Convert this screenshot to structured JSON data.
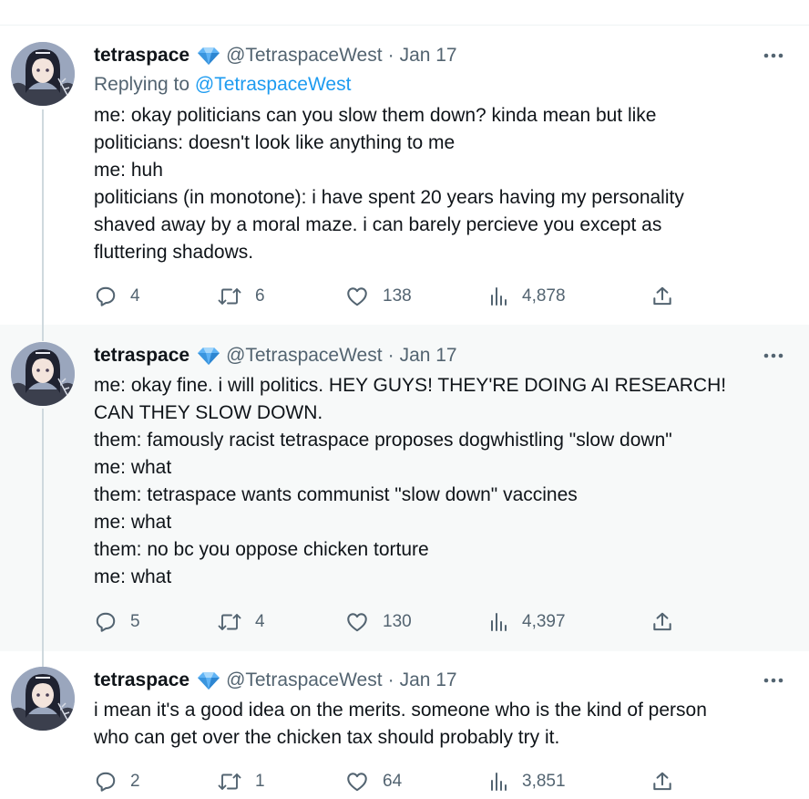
{
  "tweets": [
    {
      "name": "tetraspace",
      "handle": "@TetraspaceWest",
      "separator": "·",
      "date": "Jan 17",
      "replying_prefix": "Replying to ",
      "replying_handle": "@TetraspaceWest",
      "lines": [
        "me: okay politicians can you slow them down? kinda mean but like",
        "politicians: doesn't look like anything to me",
        "me: huh",
        "politicians (in monotone): i have spent 20 years having my personality",
        "shaved away by a moral maze. i can barely percieve you except as",
        "fluttering shadows."
      ],
      "replies": "4",
      "retweets": "6",
      "likes": "138",
      "views": "4,878"
    },
    {
      "name": "tetraspace",
      "handle": "@TetraspaceWest",
      "separator": "·",
      "date": "Jan 17",
      "lines": [
        "me: okay fine. i will politics. HEY GUYS! THEY'RE DOING AI RESEARCH!",
        "CAN THEY SLOW DOWN.",
        "them: famously racist tetraspace proposes dogwhistling \"slow down\"",
        "me: what",
        "them: tetraspace wants communist \"slow down\" vaccines",
        "me: what",
        "them: no bc you oppose chicken torture",
        "me: what"
      ],
      "replies": "5",
      "retweets": "4",
      "likes": "130",
      "views": "4,397"
    },
    {
      "name": "tetraspace",
      "handle": "@TetraspaceWest",
      "separator": "·",
      "date": "Jan 17",
      "lines": [
        "i mean it's a good idea on the merits. someone who is the kind of person",
        "who can get over the chicken tax should probably try it."
      ],
      "replies": "2",
      "retweets": "1",
      "likes": "64",
      "views": "3,851"
    }
  ],
  "icons": {
    "verified": "verified-diamond-icon",
    "more": "more-dots-icon",
    "reply": "reply-icon",
    "retweet": "retweet-icon",
    "like": "heart-icon",
    "views": "views-chart-icon",
    "share": "share-icon"
  },
  "colors": {
    "text": "#0f1419",
    "secondary": "#536471",
    "link": "#1d9bf0",
    "verified": "#1d9bf0",
    "highlight_bg": "#f7f9f9",
    "thread_line": "#cfd9de"
  }
}
